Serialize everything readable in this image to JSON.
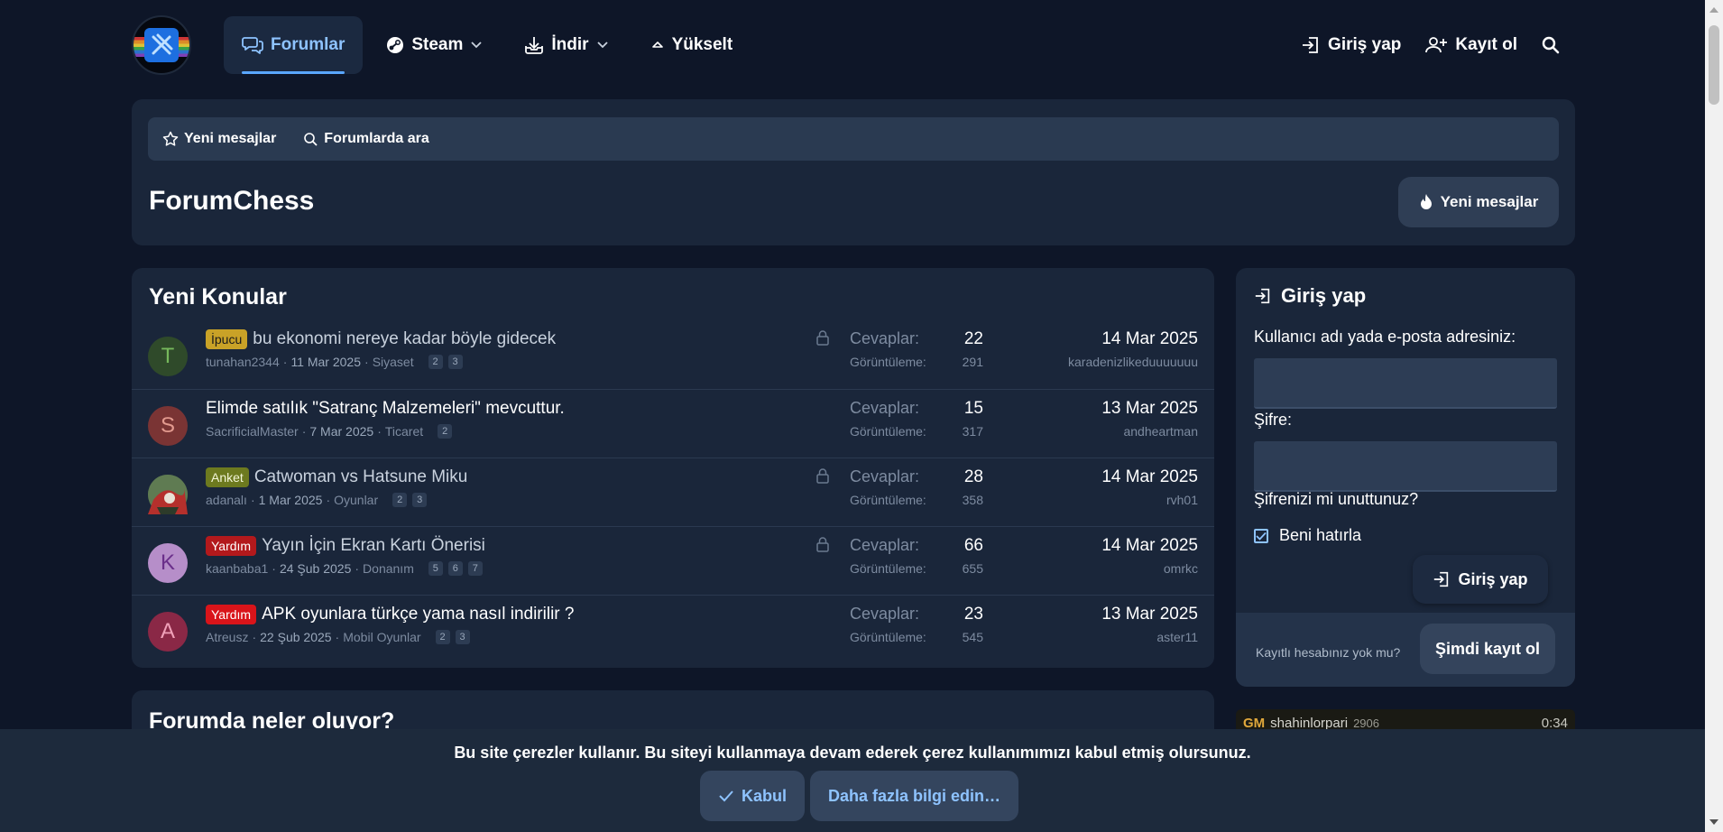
{
  "nav": {
    "items": [
      {
        "label": "Forumlar",
        "icon": "chat-bubbles-icon",
        "active": true,
        "dropdown": false
      },
      {
        "label": "Steam",
        "icon": "steam-icon",
        "active": false,
        "dropdown": true
      },
      {
        "label": "İndir",
        "icon": "download-tray-icon",
        "active": false,
        "dropdown": true
      },
      {
        "label": "Yükselt",
        "icon": "chevron-up-icon",
        "active": false,
        "dropdown": false
      }
    ],
    "login_label": "Giriş yap",
    "register_label": "Kayıt ol"
  },
  "subnav": {
    "new_posts": "Yeni mesajlar",
    "search_forums": "Forumlarda ara"
  },
  "page": {
    "title": "ForumChess",
    "new_posts_button": "Yeni mesajlar"
  },
  "topics": {
    "title": "Yeni Konular",
    "replies_label": "Cevaplar:",
    "views_label": "Görüntüleme:",
    "rows": [
      {
        "avatar_letter": "T",
        "avatar_color": "#2f4a2a",
        "avatar_text_color": "#76b85c",
        "prefix": "İpucu",
        "prefix_bg": "#c9a227",
        "prefix_color": "#1a1a1a",
        "title": "bu ekonomi nereye kadar böyle gidecek",
        "read": true,
        "author": "tunahan2344",
        "date": "11 Mar 2025",
        "forum": "Siyaset",
        "pages": [
          "2",
          "3"
        ],
        "locked": true,
        "replies": "22",
        "views": "291",
        "last_date": "14 Mar 2025",
        "last_user": "karadenizlikeduuuuuuu"
      },
      {
        "avatar_letter": "S",
        "avatar_color": "#7a3434",
        "avatar_text_color": "#e39a8f",
        "prefix": "",
        "prefix_bg": "",
        "prefix_color": "",
        "title": "Elimde satılık \"Satranç Malzemeleri\" mevcuttur.",
        "read": false,
        "author": "SacrificialMaster",
        "date": "7 Mar 2025",
        "forum": "Ticaret",
        "pages": [
          "2"
        ],
        "locked": false,
        "replies": "15",
        "views": "317",
        "last_date": "13 Mar 2025",
        "last_user": "andheartman"
      },
      {
        "avatar_letter": "",
        "avatar_color": "#4c6a4a",
        "avatar_text_color": "#ffffff",
        "prefix": "Anket",
        "prefix_bg": "#6d7a1f",
        "prefix_color": "#f3f6d8",
        "title": "Catwoman vs Hatsune Miku",
        "read": true,
        "author": "adanalı",
        "date": "1 Mar 2025",
        "forum": "Oyunlar",
        "pages": [
          "2",
          "3"
        ],
        "locked": true,
        "replies": "28",
        "views": "358",
        "last_date": "14 Mar 2025",
        "last_user": "rvh01"
      },
      {
        "avatar_letter": "K",
        "avatar_color": "#b68ec9",
        "avatar_text_color": "#6a2f8a",
        "prefix": "Yardım",
        "prefix_bg": "#b3191c",
        "prefix_color": "#ffffff",
        "title": "Yayın İçin Ekran Kartı Önerisi",
        "read": true,
        "author": "kaanbaba1",
        "date": "24 Şub 2025",
        "forum": "Donanım",
        "pages": [
          "5",
          "6",
          "7"
        ],
        "locked": true,
        "replies": "66",
        "views": "655",
        "last_date": "14 Mar 2025",
        "last_user": "omrkc"
      },
      {
        "avatar_letter": "A",
        "avatar_color": "#8a2846",
        "avatar_text_color": "#f0a0b8",
        "prefix": "Yardım",
        "prefix_bg": "#d9141a",
        "prefix_color": "#ffffff",
        "title": "APK oyunlara türkçe yama nasıl indirilir ?",
        "read": false,
        "author": "Atreusz",
        "date": "22 Şub 2025",
        "forum": "Mobil Oyunlar",
        "pages": [
          "2",
          "3"
        ],
        "locked": false,
        "replies": "23",
        "views": "545",
        "last_date": "13 Mar 2025",
        "last_user": "aster11"
      }
    ]
  },
  "whatsup": {
    "title": "Forumda neler oluyor?"
  },
  "login": {
    "title": "Giriş yap",
    "username_label": "Kullanıcı adı yada e-posta adresiniz:",
    "username_value": "",
    "password_label": "Şifre:",
    "password_value": "",
    "forgot": "Şifrenizi mi unuttunuz?",
    "remember": "Beni hatırla",
    "remember_checked": true,
    "submit": "Giriş yap",
    "no_account": "Kayıtlı hesabınız yok mu?",
    "signup": "Şimdi kayıt ol"
  },
  "game": {
    "title": "GM",
    "player": "shahinlorpari",
    "rating": "2906",
    "clock": "0:34"
  },
  "cookie": {
    "text": "Bu site çerezler kullanır. Bu siteyi kullanmaya devam ederek çerez kullanımımızı kabul etmiş olursunuz.",
    "accept": "Kabul",
    "more": "Daha fazla bilgi edin…"
  }
}
